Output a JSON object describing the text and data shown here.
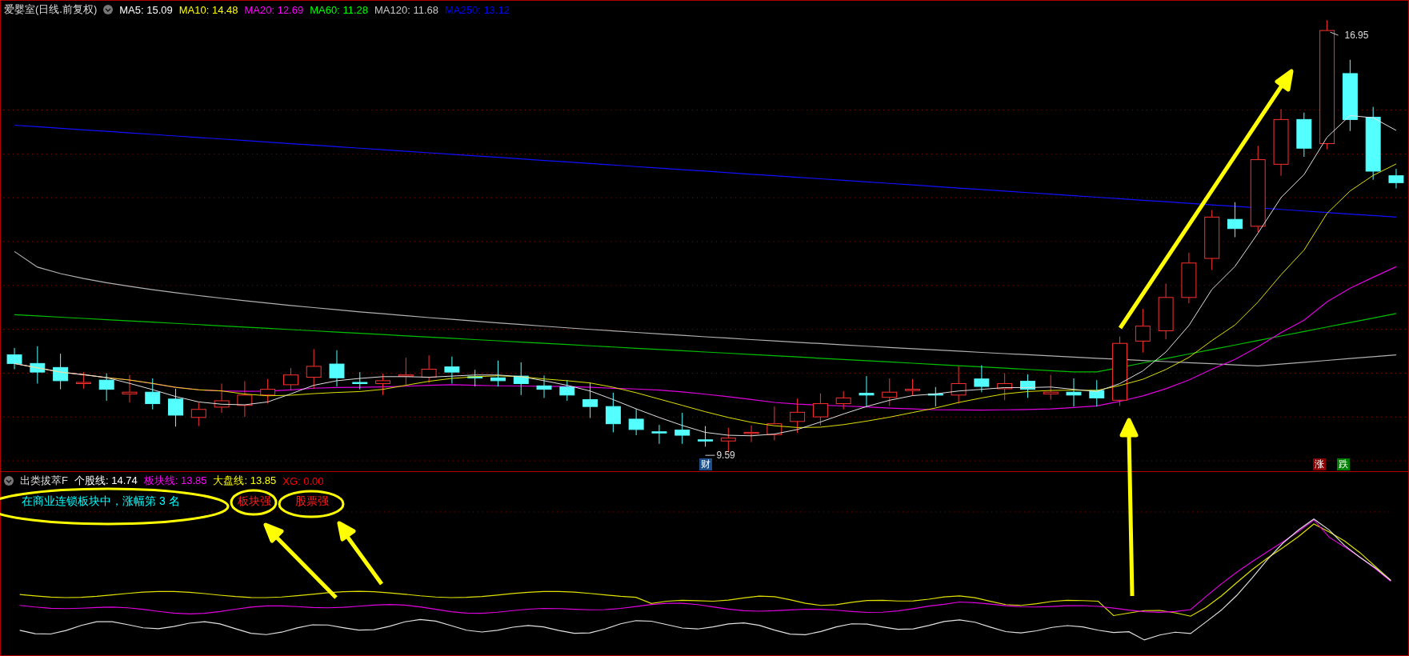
{
  "main_chart": {
    "title": "爱婴室(日线.前复权)",
    "moving_averages": [
      {
        "label": "MA5: 15.09",
        "color": "#ffffff"
      },
      {
        "label": "MA10: 14.48",
        "color": "#ffff00"
      },
      {
        "label": "MA20: 12.69",
        "color": "#ff00ff"
      },
      {
        "label": "MA60: 11.28",
        "color": "#00ff00"
      },
      {
        "label": "MA120: 11.68",
        "color": "#c8c8c8"
      },
      {
        "label": "MA250: 13.12",
        "color": "#0000ff"
      }
    ],
    "high_label": "16.95",
    "low_label": "9.59",
    "event_marker": "财",
    "badges": [
      {
        "text": "涨",
        "color": "#8b0000"
      },
      {
        "text": "跌",
        "color": "#008000"
      }
    ]
  },
  "indicator": {
    "name": "出类拔萃F",
    "values": [
      {
        "label": "个股线: 14.74",
        "color": "#ffffff"
      },
      {
        "label": "板块线: 13.85",
        "color": "#ff00ff"
      },
      {
        "label": "大盘线: 13.85",
        "color": "#ffff00"
      },
      {
        "label": "XG: 0.00",
        "color": "#ff0000"
      }
    ],
    "message": "在商业连锁板块中，涨幅第 3 名",
    "signals": [
      "板块强",
      "股票强"
    ]
  }
}
